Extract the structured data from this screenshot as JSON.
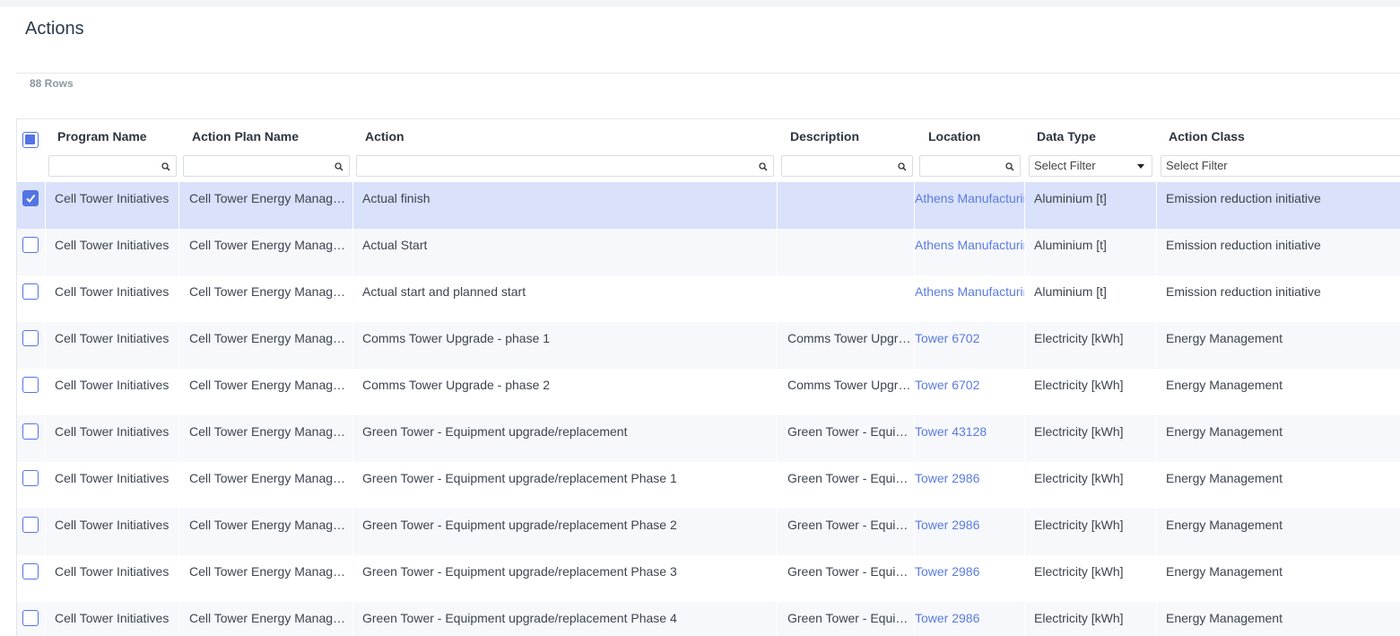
{
  "page": {
    "title": "Actions",
    "row_count": "88 Rows"
  },
  "columns": [
    {
      "key": "program",
      "label": "Program Name",
      "filter": "text"
    },
    {
      "key": "plan",
      "label": "Action Plan Name",
      "filter": "text"
    },
    {
      "key": "action",
      "label": "Action",
      "filter": "text"
    },
    {
      "key": "description",
      "label": "Description",
      "filter": "text"
    },
    {
      "key": "location",
      "label": "Location",
      "filter": "text"
    },
    {
      "key": "datatype",
      "label": "Data Type",
      "filter": "select",
      "placeholder": "Select Filter"
    },
    {
      "key": "actionclass",
      "label": "Action Class",
      "filter": "select",
      "placeholder": "Select Filter"
    }
  ],
  "rows": [
    {
      "selected": true,
      "program": "Cell Tower Initiatives",
      "plan": "Cell Tower Energy Management",
      "action": "Actual finish",
      "description": "",
      "location": "Athens Manufacturing",
      "datatype": "Aluminium [t]",
      "actionclass": "Emission reduction initiative"
    },
    {
      "selected": false,
      "program": "Cell Tower Initiatives",
      "plan": "Cell Tower Energy Management",
      "action": "Actual Start",
      "description": "",
      "location": "Athens Manufacturing",
      "datatype": "Aluminium [t]",
      "actionclass": "Emission reduction initiative"
    },
    {
      "selected": false,
      "program": "Cell Tower Initiatives",
      "plan": "Cell Tower Energy Management",
      "action": "Actual start and planned start",
      "description": "",
      "location": "Athens Manufacturing",
      "datatype": "Aluminium [t]",
      "actionclass": "Emission reduction initiative"
    },
    {
      "selected": false,
      "program": "Cell Tower Initiatives",
      "plan": "Cell Tower Energy Management",
      "action": "Comms Tower Upgrade - phase 1",
      "description": "Comms Tower Upgrade",
      "location": "Tower 6702",
      "datatype": "Electricity [kWh]",
      "actionclass": "Energy Management"
    },
    {
      "selected": false,
      "program": "Cell Tower Initiatives",
      "plan": "Cell Tower Energy Management",
      "action": "Comms Tower Upgrade - phase 2",
      "description": "Comms Tower Upgrade",
      "location": "Tower 6702",
      "datatype": "Electricity [kWh]",
      "actionclass": "Energy Management"
    },
    {
      "selected": false,
      "program": "Cell Tower Initiatives",
      "plan": "Cell Tower Energy Management",
      "action": "Green Tower - Equipment upgrade/replacement",
      "description": "Green Tower - Equipment",
      "location": "Tower 43128",
      "datatype": "Electricity [kWh]",
      "actionclass": "Energy Management"
    },
    {
      "selected": false,
      "program": "Cell Tower Initiatives",
      "plan": "Cell Tower Energy Management",
      "action": "Green Tower - Equipment upgrade/replacement Phase 1",
      "description": "Green Tower - Equipment",
      "location": "Tower 2986",
      "datatype": "Electricity [kWh]",
      "actionclass": "Energy Management"
    },
    {
      "selected": false,
      "program": "Cell Tower Initiatives",
      "plan": "Cell Tower Energy Management",
      "action": "Green Tower - Equipment upgrade/replacement Phase 2",
      "description": "Green Tower - Equipment",
      "location": "Tower 2986",
      "datatype": "Electricity [kWh]",
      "actionclass": "Energy Management"
    },
    {
      "selected": false,
      "program": "Cell Tower Initiatives",
      "plan": "Cell Tower Energy Management",
      "action": "Green Tower - Equipment upgrade/replacement Phase 3",
      "description": "Green Tower - Equipment",
      "location": "Tower 2986",
      "datatype": "Electricity [kWh]",
      "actionclass": "Energy Management"
    },
    {
      "selected": false,
      "program": "Cell Tower Initiatives",
      "plan": "Cell Tower Energy Management",
      "action": "Green Tower - Equipment upgrade/replacement Phase 4",
      "description": "Green Tower - Equipment",
      "location": "Tower 2986",
      "datatype": "Electricity [kWh]",
      "actionclass": "Energy Management"
    }
  ],
  "icons": {
    "filter_search": "magnifier-icon",
    "select_arrow": "caret-down-icon",
    "row_checkbox": "checkbox-icon"
  },
  "colors": {
    "accent": "#5474e3",
    "selected_row": "#d9e1fb",
    "link": "#5a7be0"
  }
}
